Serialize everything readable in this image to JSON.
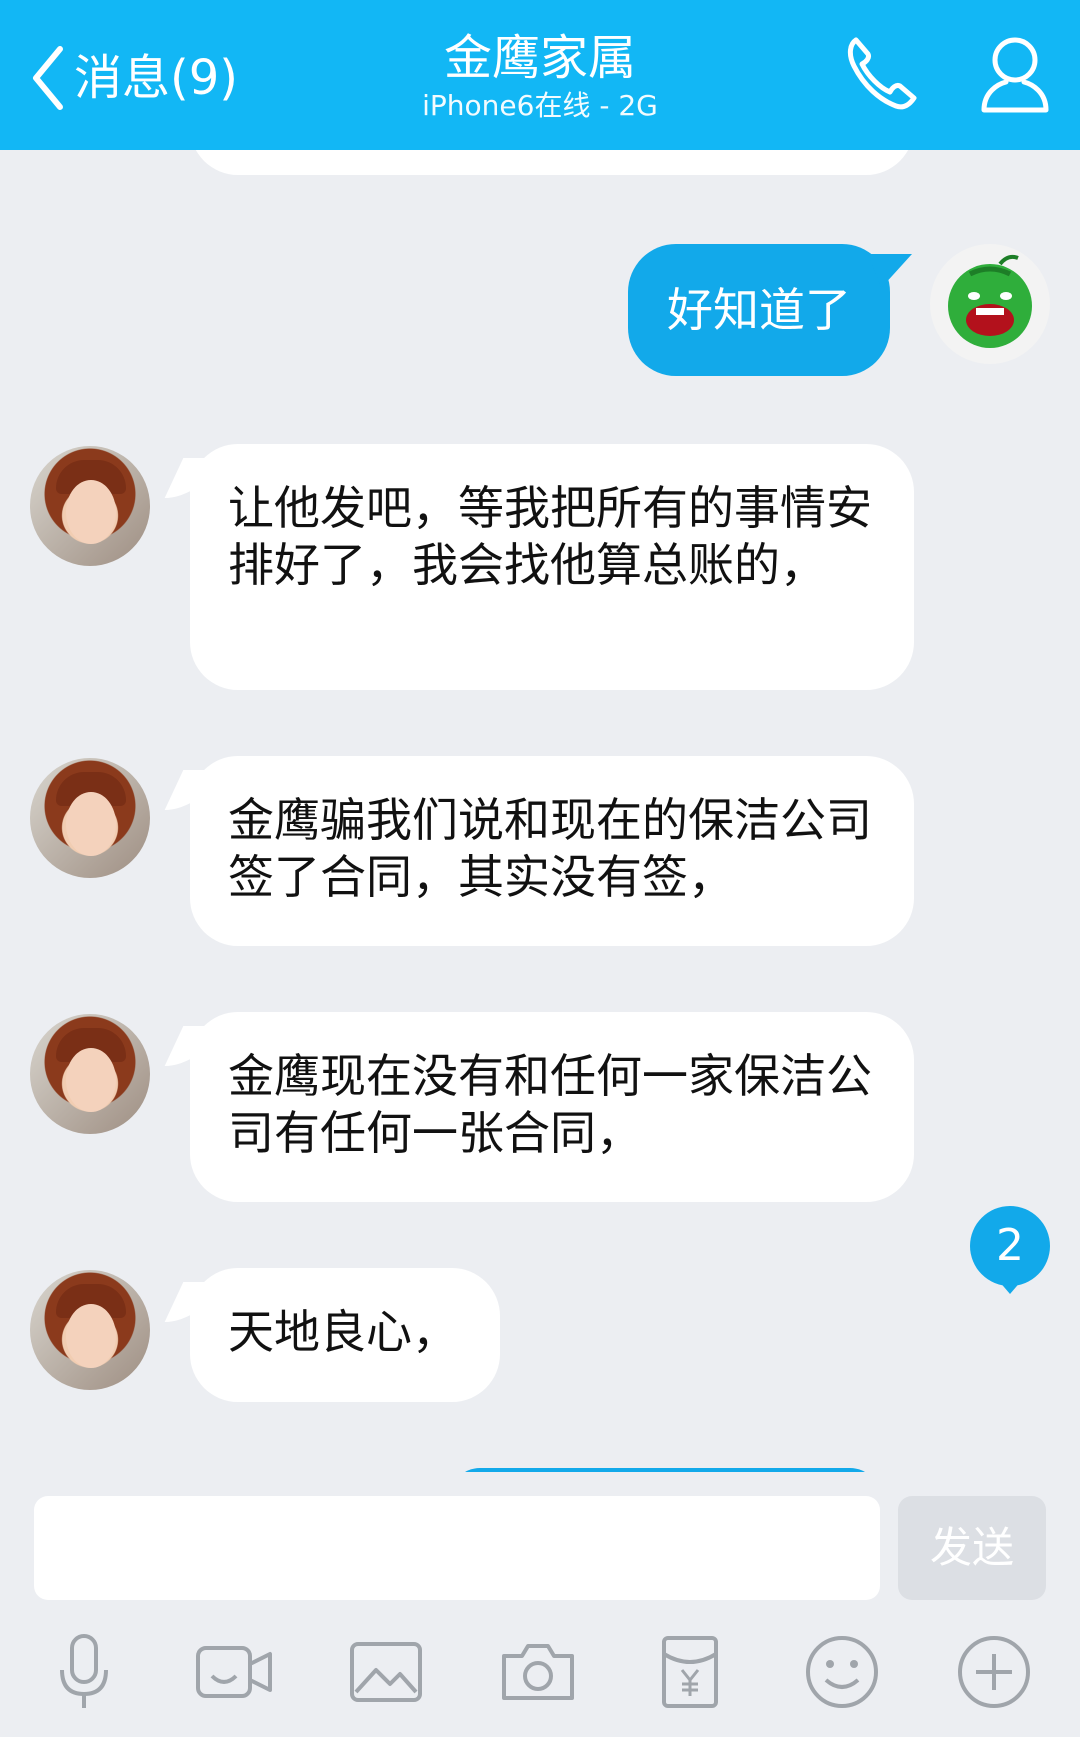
{
  "header": {
    "back_label": "消息(9)",
    "title": "金鹰家属",
    "subtitle": "iPhone6在线 - 2G"
  },
  "messages": [
    {
      "side": "out",
      "text": "好知道了"
    },
    {
      "side": "in",
      "text": "让他发吧，等我把所有的事情安排好了，我会找他算总账的，"
    },
    {
      "side": "in",
      "text": "金鹰骗我们说和现在的保洁公司签了合同，其实没有签，"
    },
    {
      "side": "in",
      "text": "金鹰现在没有和任何一家保洁公司有任何一张合同，"
    },
    {
      "side": "in",
      "text": "天地良心，"
    }
  ],
  "unread_badge": "2",
  "input": {
    "value": "",
    "send_label": "发送"
  },
  "toolbar": {
    "icons": [
      "microphone-icon",
      "video-icon",
      "image-icon",
      "camera-icon",
      "red-packet-icon",
      "emoji-icon",
      "plus-icon"
    ]
  },
  "colors": {
    "accent": "#12b7f5",
    "bubble_out": "#12a9ea",
    "background": "#eceef2"
  }
}
